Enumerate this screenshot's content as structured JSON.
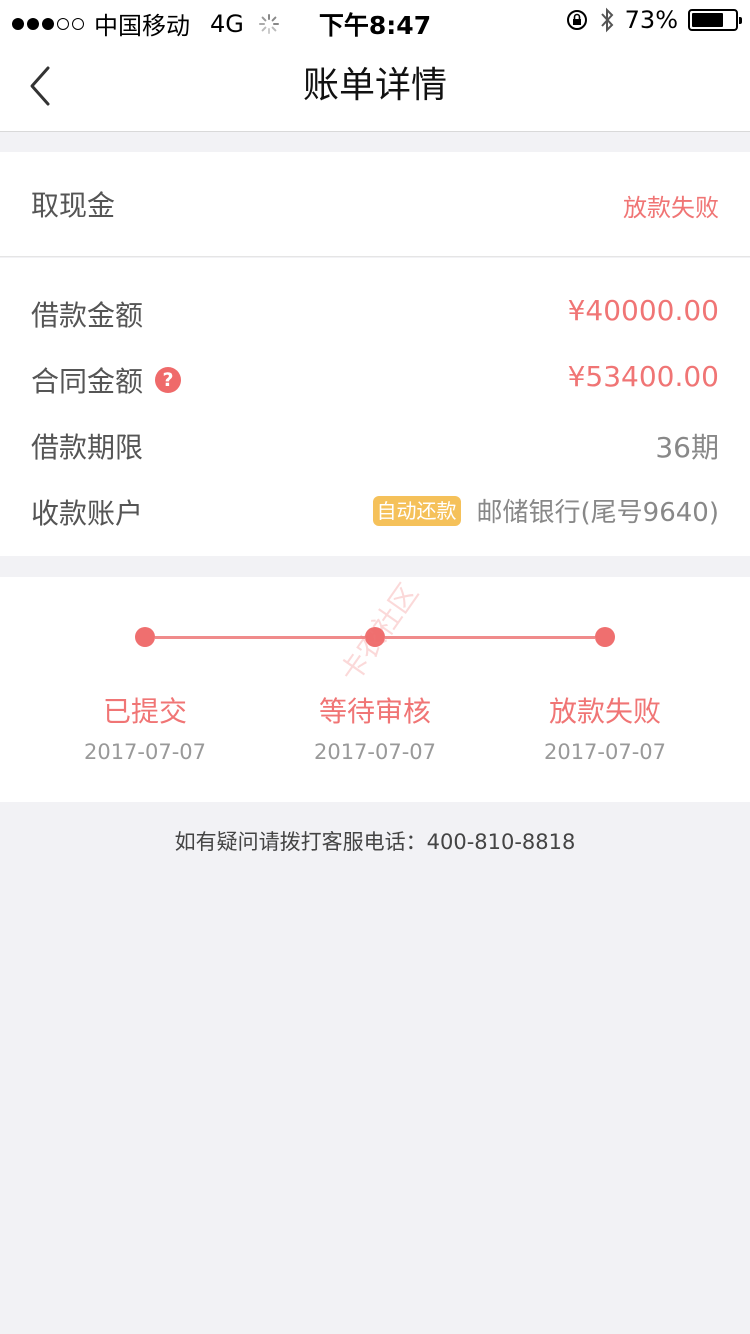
{
  "status_bar": {
    "carrier": "中国移动",
    "network": "4G",
    "time": "下午8:47",
    "battery_percent": "73%",
    "battery_level": 0.73
  },
  "nav": {
    "title": "账单详情"
  },
  "summary": {
    "type": "取现金",
    "status": "放款失败"
  },
  "details": {
    "loan_amount_label": "借款金额",
    "loan_amount": "¥40000.00",
    "contract_amount_label": "合同金额",
    "contract_amount": "¥53400.00",
    "term_label": "借款期限",
    "term": "36期",
    "account_label": "收款账户",
    "auto_repay_badge": "自动还款",
    "account": "邮储银行(尾号9640)"
  },
  "progress": {
    "steps": [
      {
        "title": "已提交",
        "date": "2017-07-07"
      },
      {
        "title": "等待审核",
        "date": "2017-07-07"
      },
      {
        "title": "放款失败",
        "date": "2017-07-07"
      }
    ],
    "watermark": "卡农社区"
  },
  "footer": {
    "hint": "如有疑问请拨打客服电话：400-810-8818"
  },
  "colors": {
    "accent_red": "#f07575",
    "badge_yellow": "#f5c15a",
    "background": "#f2f2f5"
  }
}
